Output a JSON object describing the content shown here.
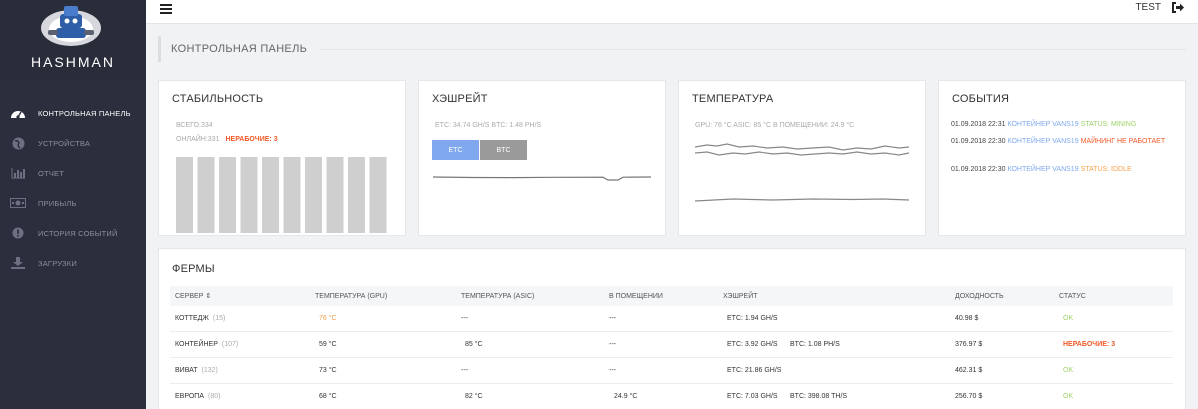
{
  "brand": {
    "name": "HASHMAN",
    "logo_icon": "robot-mascot-icon"
  },
  "topbar": {
    "user": "TEST",
    "logout_icon": "logout-icon",
    "menu_icon": "hamburger-icon"
  },
  "sidebar": {
    "items": [
      {
        "label": "КОНТРОЛЬНАЯ ПАНЕЛЬ",
        "icon": "speedometer-icon",
        "active": true
      },
      {
        "label": "УСТРОЙСТВА",
        "icon": "globe-icon",
        "active": false
      },
      {
        "label": "ОТЧЕТ",
        "icon": "bar-chart-icon",
        "active": false
      },
      {
        "label": "ПРИБЫЛЬ",
        "icon": "money-icon",
        "active": false
      },
      {
        "label": "ИСТОРИЯ СОБЫТИЙ",
        "icon": "alert-icon",
        "active": false
      },
      {
        "label": "ЗАГРУЗКИ",
        "icon": "download-icon",
        "active": false
      }
    ]
  },
  "page": {
    "title": "КОНТРОЛЬНАЯ ПАНЕЛЬ"
  },
  "stability": {
    "title": "СТАБИЛЬНОСТЬ",
    "total": "ВСЕГО:334",
    "online": "ОНЛАЙН:331",
    "not_working": "НЕРАБОЧИЕ: 3",
    "bar_count": 10
  },
  "hashrate": {
    "title": "ХЭШРЕЙТ",
    "stats": "ETC: 34.74 GH/S    BTC: 1.48 PH/S",
    "btn_etc": "ETC",
    "btn_btc": "BTC"
  },
  "temperature": {
    "title": "ТЕМПЕРАТУРА",
    "stats": "GPU: 76 °C    ASIC: 85 °C    В ПОМЕЩЕНИИ: 24.9 °C"
  },
  "events": {
    "title": "СОБЫТИЯ",
    "items": [
      {
        "time": "01.09.2018 22:31",
        "source": "КОНТЕЙНЕР VANS19",
        "message": "STATUS: MINING",
        "tone": "green"
      },
      {
        "time": "01.09.2018 22:30",
        "source": "КОНТЕЙНЕР VANS19",
        "message": "МАЙНИНГ НЕ РАБОТАЕТ",
        "tone": "red"
      },
      {
        "time": "01.09.2018 22:30",
        "source": "КОНТЕЙНЕР VANS19",
        "message": "STATUS: IDDLE",
        "tone": "orange"
      }
    ]
  },
  "farms": {
    "title": "ФЕРМЫ",
    "columns": {
      "server": "СЕРВЕР ⇕",
      "gpu": "ТЕМПЕРАТУРА (GPU)",
      "asic": "ТЕМПЕРАТУРА (ASIC)",
      "room": "В ПОМЕЩЕНИИ",
      "hashrate": "ХЭШРЕЙТ",
      "income": "ДОХОДНОСТЬ",
      "status": "СТАТУС"
    },
    "rows": [
      {
        "name": "КОТТЕДЖ",
        "count": "(15)",
        "gpu": "76 °C",
        "asic": "---",
        "room": "---",
        "hash1": "ETC: 1.94 GH/S",
        "hash2": "",
        "income": "40.98 $",
        "status": "OK"
      },
      {
        "name": "КОНТЕЙНЕР",
        "count": "(107)",
        "gpu": "59 °C",
        "asic": "85 °C",
        "room": "---",
        "hash1": "ETC: 3.92 GH/S",
        "hash2": "BTC: 1.08 PH/S",
        "income": "376.97 $",
        "status": "НЕРАБОЧИЕ: 3"
      },
      {
        "name": "ВИВАТ",
        "count": "(132)",
        "gpu": "73 °C",
        "asic": "---",
        "room": "---",
        "hash1": "ETC: 21.86 GH/S",
        "hash2": "",
        "income": "462.31 $",
        "status": "OK"
      },
      {
        "name": "ЕВРОПА",
        "count": "(80)",
        "gpu": "68 °C",
        "asic": "82 °C",
        "room": "24.9 °C",
        "hash1": "ETC: 7.03 GH/S",
        "hash2": "BTC: 398.08 TH/S",
        "income": "256.70 $",
        "status": "OK"
      }
    ]
  },
  "colors": {
    "accent": "#7fa8ef",
    "danger": "#f05a28",
    "ok": "#9ed36a",
    "sidebar": "#2b2e3c"
  }
}
